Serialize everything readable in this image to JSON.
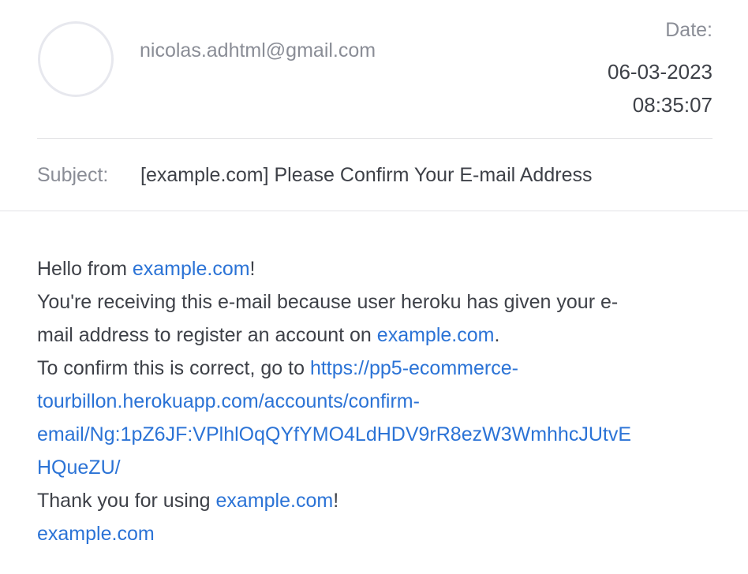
{
  "email": {
    "from": "nicolas.adhtml@gmail.com",
    "date_label": "Date:",
    "date": "06-03-2023",
    "time": "08:35:07",
    "subject_label": "Subject:",
    "subject": "[example.com] Please Confirm Your E-mail Address"
  },
  "body": {
    "hello_prefix": "Hello from ",
    "site_link": "example.com",
    "hello_suffix": "!",
    "line2": "You're receiving this e-mail because user heroku has given your e-",
    "line3_prefix": "mail address to register an account on ",
    "line3_suffix": ".",
    "line4_prefix": "To confirm this is correct, go to ",
    "confirm_link_part1": "https://pp5-ecommerce-",
    "confirm_link_part2": "tourbillon.herokuapp.com/accounts/confirm-",
    "confirm_link_part3": "email/Ng:1pZ6JF:VPlhlOqQYfYMO4LdHDV9rR8ezW3WmhhcJUtvE",
    "confirm_link_part4": "HQueZU/",
    "thanks_prefix": "Thank you for using ",
    "thanks_suffix": "!",
    "signature_link": "example.com"
  }
}
